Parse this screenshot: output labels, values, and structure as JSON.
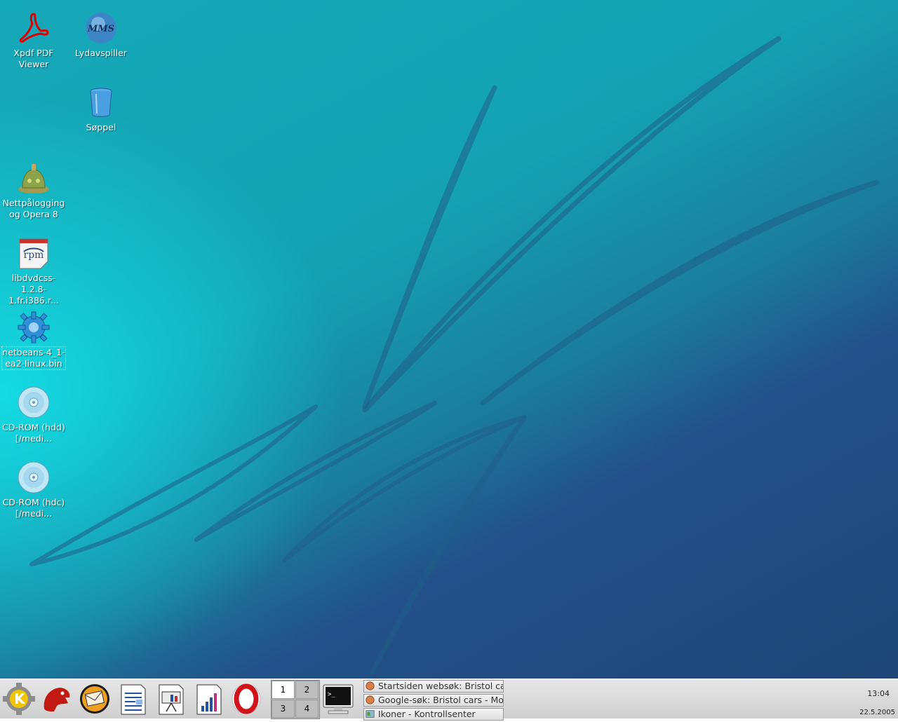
{
  "desktop": {
    "icons": [
      {
        "label": "Xpdf PDF Viewer",
        "icon": "pdf-icon"
      },
      {
        "label": "Lydavspiller",
        "icon": "xmms-icon"
      },
      {
        "label": "Søppel",
        "icon": "trash-icon"
      },
      {
        "label": "Nettpålogging og Opera 8",
        "icon": "dialup-icon"
      },
      {
        "label": "libdvdcss-1.2.8-1.fr.i386.r...",
        "icon": "rpm-package-icon"
      },
      {
        "label": "netbeans-4_1-ea2-linux.bin",
        "icon": "gear-executable-icon"
      },
      {
        "label": "CD-ROM (hdd) [/medi...",
        "icon": "cdrom-icon"
      },
      {
        "label": "CD-ROM (hdc) [/medi...",
        "icon": "cdrom-icon"
      }
    ]
  },
  "taskbar": {
    "launchers": [
      {
        "name": "kde-menu-icon"
      },
      {
        "name": "mozilla-icon"
      },
      {
        "name": "mail-icon"
      },
      {
        "name": "writer-icon"
      },
      {
        "name": "impress-icon"
      },
      {
        "name": "calc-icon"
      },
      {
        "name": "opera-icon"
      }
    ],
    "pager": {
      "desktops": [
        "1",
        "2",
        "3",
        "4"
      ],
      "active": "1"
    },
    "terminal": "terminal-icon",
    "tasks": [
      {
        "label": "Startsiden websøk: Bristol cars"
      },
      {
        "label": "Google-søk: Bristol cars - Mozilla"
      },
      {
        "label": "Ikoner - Kontrollsenter"
      }
    ],
    "clock": "13:04",
    "date": "22.5.2005"
  }
}
